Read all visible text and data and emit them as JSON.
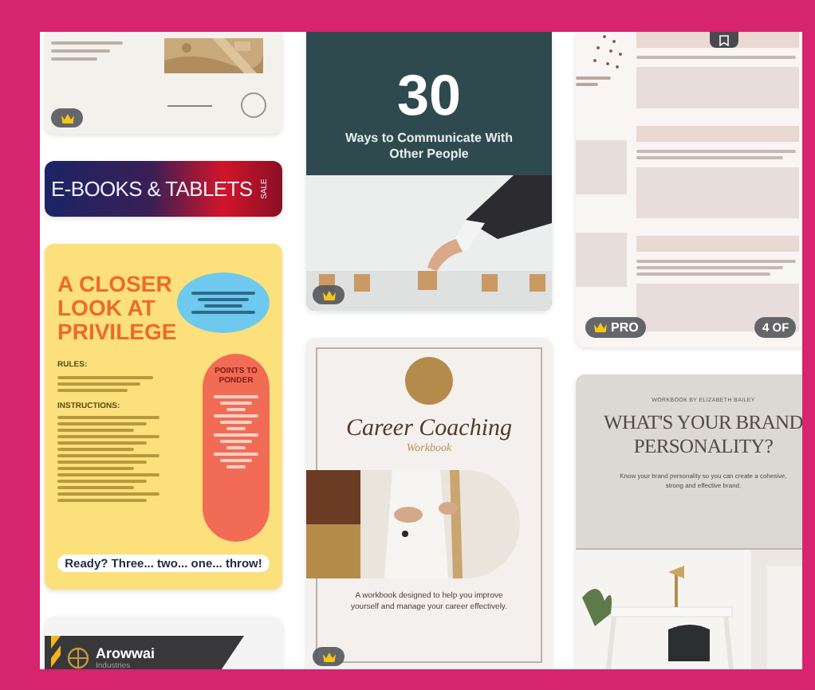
{
  "columns": [
    {
      "cards": [
        {
          "kind": "worksheet-photo",
          "badge": {
            "kind": "crown"
          }
        },
        {
          "kind": "banner",
          "title": "E-BOOKS & TABLETS",
          "tag": "SALE"
        },
        {
          "kind": "poster",
          "title": "A CLOSER LOOK AT PRIVILEGE",
          "sections": [
            "RULES:",
            "INSTRUCTIONS:"
          ],
          "side_heading": "POINTS TO PONDER",
          "cta": "Ready? Three... two... one... throw!"
        },
        {
          "kind": "logo",
          "name": "Arowwai",
          "subtitle": "Industries"
        }
      ]
    },
    {
      "cards": [
        {
          "kind": "cover",
          "number": "30",
          "title": "Ways to Communicate With Other People",
          "badge": {
            "kind": "crown"
          }
        },
        {
          "kind": "workbook",
          "title": "Career Coaching",
          "subtitle": "Workbook",
          "description": "A workbook designed to help you improve yourself and manage your career effectively.",
          "badge": {
            "kind": "crown"
          }
        }
      ]
    },
    {
      "cards": [
        {
          "kind": "worksheet",
          "badge": {
            "kind": "pro",
            "label": "PRO"
          },
          "pager": "4 OF",
          "bookmark": true
        },
        {
          "kind": "brand",
          "byline": "WORKBOOK BY ELIZABETH BAILEY",
          "title": "WHAT'S YOUR BRAND PERSONALITY?",
          "description": "Know your brand personality so you can create a cohesive, strong and effective brand."
        }
      ]
    }
  ]
}
